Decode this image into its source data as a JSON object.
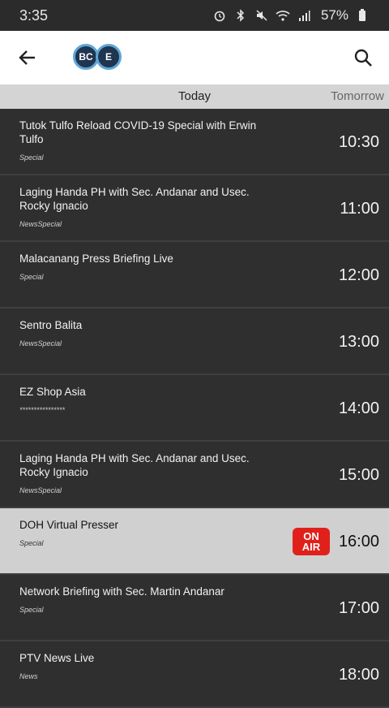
{
  "status_bar": {
    "time": "3:35",
    "battery": "57%",
    "icons": [
      "alarm-icon",
      "bluetooth-icon",
      "mute-icon",
      "wifi-icon",
      "signal-icon",
      "battery-icon"
    ]
  },
  "app_bar": {
    "back_icon": "arrow-left-icon",
    "logo_letters": [
      "BC",
      "E"
    ],
    "search_icon": "search-icon"
  },
  "tabs": {
    "today": "Today",
    "tomorrow": "Tomorrow"
  },
  "programs": [
    {
      "title": "Tutok Tulfo Reload COVID-19 Special with Erwin Tulfo",
      "category": "Special",
      "time": "10:30",
      "on_air": false
    },
    {
      "title": "Laging Handa PH with Sec. Andanar and Usec. Rocky Ignacio",
      "category": "NewsSpecial",
      "time": "11:00",
      "on_air": false
    },
    {
      "title": "Malacanang Press Briefing Live",
      "category": "Special",
      "time": "12:00",
      "on_air": false
    },
    {
      "title": "Sentro Balita",
      "category": "NewsSpecial",
      "time": "13:00",
      "on_air": false
    },
    {
      "title": "EZ Shop Asia",
      "category": "****************",
      "time": "14:00",
      "on_air": false
    },
    {
      "title": "Laging Handa PH with Sec. Andanar and Usec. Rocky Ignacio",
      "category": "NewsSpecial",
      "time": "15:00",
      "on_air": false
    },
    {
      "title": "DOH Virtual Presser",
      "category": "Special",
      "time": "16:00",
      "on_air": true,
      "badge_line1": "ON",
      "badge_line2": "AIR"
    },
    {
      "title": "Network Briefing with Sec. Martin Andanar",
      "category": "Special",
      "time": "17:00",
      "on_air": false
    },
    {
      "title": "PTV News Live",
      "category": "News",
      "time": "18:00",
      "on_air": false
    }
  ],
  "colors": {
    "on_air_badge": "#e0211b",
    "row_bg": "#2f2f2f",
    "on_air_row_bg": "#d0d0d0",
    "tab_bar_bg": "#d4d4d4"
  }
}
